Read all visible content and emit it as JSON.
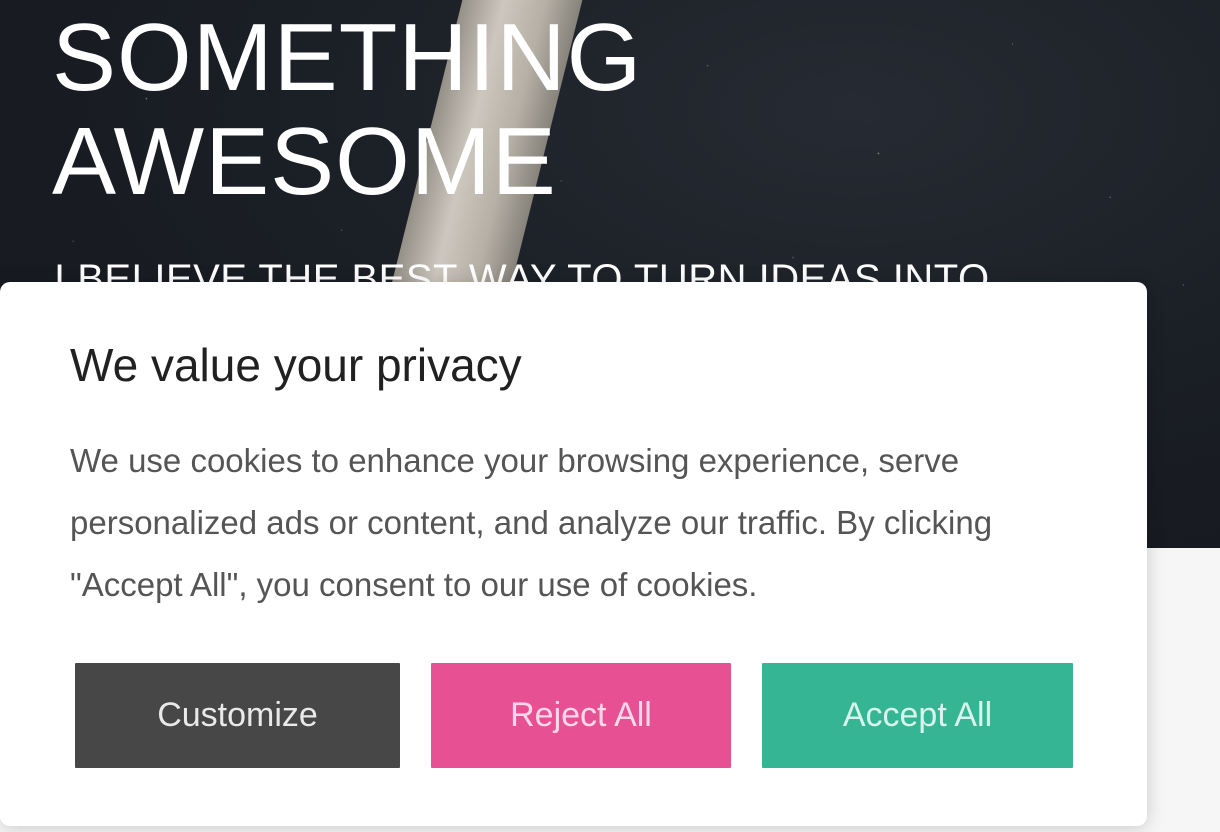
{
  "hero": {
    "title": "SOMETHING\nAWESOME",
    "subtitle": "I BELIEVE THE BEST WAY TO TURN IDEAS INTO"
  },
  "cookie_banner": {
    "title": "We value your privacy",
    "text": "We use cookies to enhance your browsing experience, serve personalized ads or content, and analyze our traffic. By clicking \"Accept All\", you consent to our use of cookies.",
    "buttons": {
      "customize": "Customize",
      "reject": "Reject All",
      "accept": "Accept All"
    }
  },
  "colors": {
    "customize_button": "#474747",
    "reject_button": "#e75194",
    "accept_button": "#35b594",
    "hero_background": "#1b1f26"
  }
}
